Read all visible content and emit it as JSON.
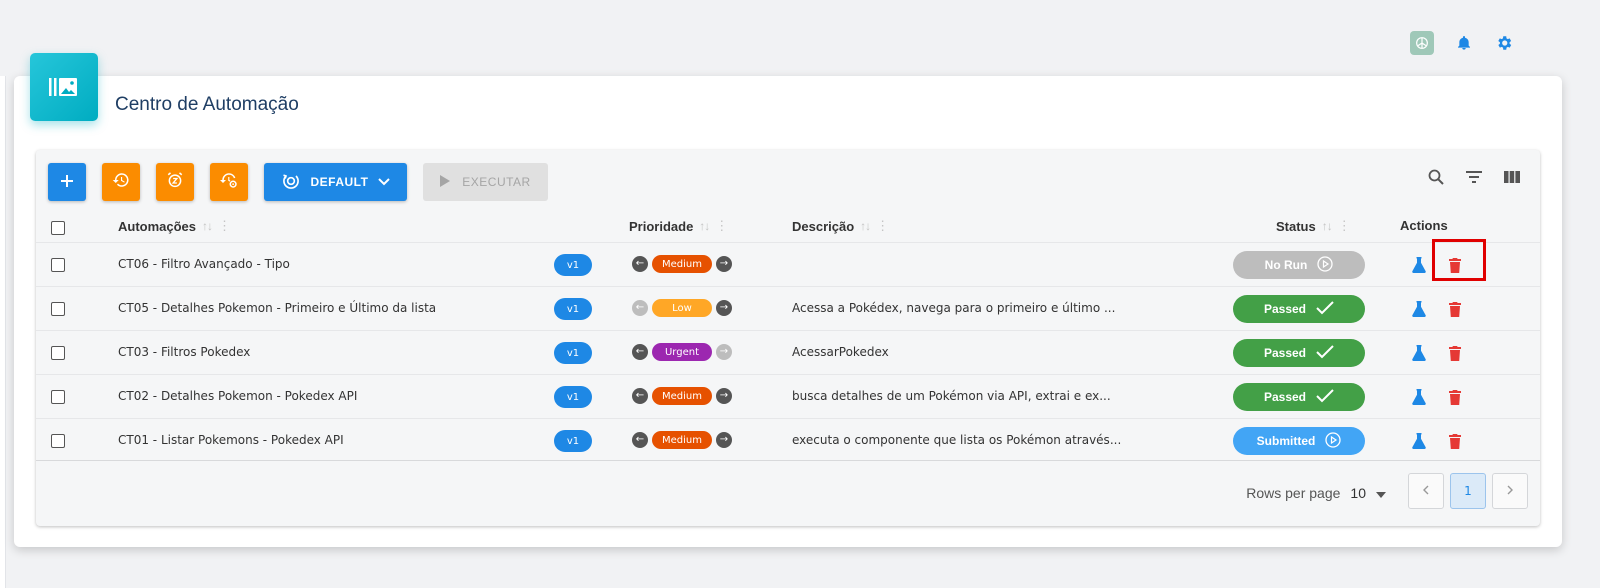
{
  "topbar": {
    "icons": [
      "ai-assistant-icon",
      "bell-icon",
      "gear-icon"
    ]
  },
  "page": {
    "title": "Centro de Automação",
    "badge_icon": "gallery-icon"
  },
  "toolbar": {
    "add_icon": "plus-icon",
    "history_icon": "history-icon",
    "schedule_icon": "snooze-alarm-icon",
    "settings_history_icon": "history-settings-icon",
    "environment_label": "DEFAULT",
    "execute_label": "EXECUTAR"
  },
  "table": {
    "columns": {
      "automacoes": "Automações",
      "prioridade": "Prioridade",
      "descricao": "Descrição",
      "status": "Status",
      "actions": "Actions"
    },
    "rows": [
      {
        "name": "CT06 - Filtro Avançado - Tipo",
        "version": "v1",
        "priority": "Medium",
        "priority_color": "#e65100",
        "left_arrow": "dark",
        "right_arrow": "dark",
        "description": "",
        "status": "No Run",
        "status_color": "#bdbdbd",
        "status_icon": "play"
      },
      {
        "name": "CT05 - Detalhes Pokemon - Primeiro e Último da lista",
        "version": "v1",
        "priority": "Low",
        "priority_color": "#ffa726",
        "left_arrow": "light",
        "right_arrow": "dark",
        "description": "Acessa a Pokédex, navega para o primeiro e último ...",
        "status": "Passed",
        "status_color": "#43a047",
        "status_icon": "check"
      },
      {
        "name": "CT03 - Filtros Pokedex",
        "version": "v1",
        "priority": "Urgent",
        "priority_color": "#9c27b0",
        "left_arrow": "dark",
        "right_arrow": "light",
        "description": "AcessarPokedex",
        "status": "Passed",
        "status_color": "#43a047",
        "status_icon": "check"
      },
      {
        "name": "CT02 - Detalhes Pokemon - Pokedex API",
        "version": "v1",
        "priority": "Medium",
        "priority_color": "#e65100",
        "left_arrow": "dark",
        "right_arrow": "dark",
        "description": "busca detalhes de um Pokémon via API, extrai e ex...",
        "status": "Passed",
        "status_color": "#43a047",
        "status_icon": "check"
      },
      {
        "name": "CT01 - Listar Pokemons - Pokedex API",
        "version": "v1",
        "priority": "Medium",
        "priority_color": "#e65100",
        "left_arrow": "dark",
        "right_arrow": "dark",
        "description": "executa o componente que lista os Pokémon através...",
        "status": "Submitted",
        "status_color": "#42a5f5",
        "status_icon": "play"
      }
    ]
  },
  "pagination": {
    "rows_per_page_label": "Rows per page",
    "rows_per_page_value": "10",
    "current_page": "1"
  },
  "colors": {
    "primary": "#1e88e5",
    "accent_orange": "#fb8c00",
    "danger": "#e53935",
    "title": "#1f3e64"
  }
}
